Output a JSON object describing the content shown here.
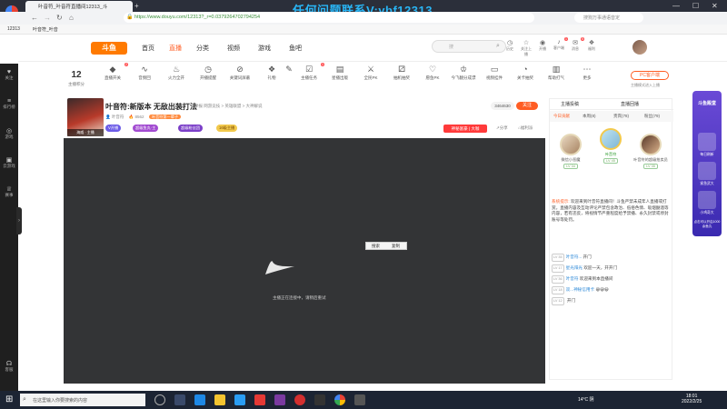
{
  "browser": {
    "tab_title": "叶音符_叶音符直播间12313_斗",
    "watermark": "任何问题联系V:ybf12313",
    "url": "https://www.douyu.com/12313?_r=0.0379264702794254",
    "search_engine_placeholder": "搜狗万事通语音定",
    "bookmarks": [
      "12313",
      "叶音符_叶音"
    ]
  },
  "left_sidebar": [
    {
      "icon": "home-icon",
      "label": "关注"
    },
    {
      "icon": "list-icon",
      "label": "排行榜"
    },
    {
      "icon": "trophy-icon",
      "label": "游戏"
    },
    {
      "icon": "gamepad-icon",
      "label": "云游戏"
    },
    {
      "icon": "cup-icon",
      "label": "赛事"
    },
    {
      "icon": "headset-icon",
      "label": "客服"
    }
  ],
  "site": {
    "logo": "斗鱼",
    "nav": [
      "首页",
      "直播",
      "分类",
      "视频",
      "游戏",
      "鱼吧"
    ],
    "active_nav": "直播",
    "search_placeholder": "搜",
    "header_icons": [
      {
        "icon": "search-icon",
        "label": "历史"
      },
      {
        "icon": "star-icon",
        "label": "关注上播"
      },
      {
        "icon": "camera-icon",
        "label": "开播"
      },
      {
        "icon": "bell-icon",
        "label": "客户端"
      },
      {
        "icon": "mail-icon",
        "label": "消息"
      },
      {
        "icon": "gift-icon",
        "label": "福利"
      }
    ],
    "header_badges": [
      "1",
      "5"
    ]
  },
  "toolbar": {
    "level_value": "12",
    "level_label": "主播积分",
    "items": [
      {
        "icon": "diamond-icon",
        "label": "直播开关",
        "badge": "2"
      },
      {
        "icon": "wave-icon",
        "label": "音频回"
      },
      {
        "icon": "fire-icon",
        "label": "火力全开"
      },
      {
        "icon": "clock-icon",
        "label": "开播提醒"
      },
      {
        "icon": "eye-off-icon",
        "label": "关键词屏蔽"
      },
      {
        "icon": "gift-icon",
        "label": "礼物"
      },
      {
        "icon": "edit-icon",
        "label": ""
      },
      {
        "icon": "task-icon",
        "label": "主播任务",
        "badge": "1"
      },
      {
        "icon": "ad-icon",
        "label": "星播出版"
      },
      {
        "icon": "vs-icon",
        "label": "全民PK"
      },
      {
        "icon": "dice-icon",
        "label": "抽机抽奖"
      },
      {
        "icon": "heart-icon",
        "label": "愿鱼PK"
      },
      {
        "icon": "crown-icon",
        "label": "今飞翻分成漂"
      },
      {
        "icon": "tv-icon",
        "label": "视频挂件"
      },
      {
        "icon": "gauge-icon",
        "label": "关卡抽奖"
      },
      {
        "icon": "box-icon",
        "label": "帮助打气"
      },
      {
        "icon": "more-icon",
        "label": "更多"
      }
    ],
    "pc_client": "PC客户端",
    "pc_client_sub": "主播模式进入上播"
  },
  "streamer": {
    "thumb_caption": "海威 · 主播",
    "title": "叶音符:新版本 无敌出装打法",
    "categories": "举报   网游竞技 > 英雄联盟 > 大神解说",
    "name": "叶音符",
    "stats": "8562",
    "badge_1": "叶音符第一辈子",
    "follow_count": "3464630",
    "follow_label": "关注",
    "pills": [
      "V开播",
      "超级鱼丸·主",
      "超级粉丝团",
      "16级主播"
    ],
    "tag_button": "神秘富豪 | 大咖",
    "actions": [
      "分享",
      "福利派"
    ]
  },
  "video": {
    "ctx_items": [
      "搜索",
      "复制"
    ],
    "message": "主播正在连接中，请稍后重试"
  },
  "right_panel": {
    "top_tabs": [
      "主播投稿",
      "直播回播"
    ],
    "tabs": [
      "今日贡献",
      "本周(8)",
      "贵宾(78)",
      "粉丝(79)"
    ],
    "rank": [
      {
        "name": "微信小恶魔",
        "level": "LV 34"
      },
      {
        "name": "叶音符",
        "level": "LV 45"
      },
      {
        "name": "叶音符的超级拍卖员",
        "level": "LV 35"
      }
    ],
    "chat": [
      {
        "type": "system",
        "label": "系统提示:",
        "text": "欢迎来到叶音符直播间！斗鱼严禁未成年人直播或打赏。直播内容及互动评论严禁包含政治、低俗色情、吸烟酗酒等内容，若有违反，将视情节严重程度给予禁播、永久封禁或停封账号等处罚。"
      },
      {
        "type": "msg",
        "level": "LV 35",
        "name": "叶音符...",
        "text": "开门"
      },
      {
        "type": "msg",
        "level": "LV 17",
        "name": "星光阳光",
        "text": "欢迎一天，开开门"
      },
      {
        "type": "msg",
        "level": "LV 36",
        "name": "叶音符",
        "text": "欢迎来到本直播间"
      },
      {
        "type": "msg",
        "level": "LV 18",
        "name": "双...神秘信用卡",
        "text": "😀😀😀"
      },
      {
        "type": "msg",
        "level": "LV 12",
        "name": "",
        "text": "开门"
      }
    ]
  },
  "float_ad": {
    "title": "斗鱼殿堂",
    "items": [
      "每日刷新",
      "紧急武大",
      "小鸡奇大"
    ],
    "footer": "点击可以开启1000余鱼丸"
  },
  "taskbar": {
    "search_placeholder": "在这里输入你要搜索的内容",
    "weather": "14°C 阴",
    "time": "18:01",
    "date": "2022/2/25"
  }
}
